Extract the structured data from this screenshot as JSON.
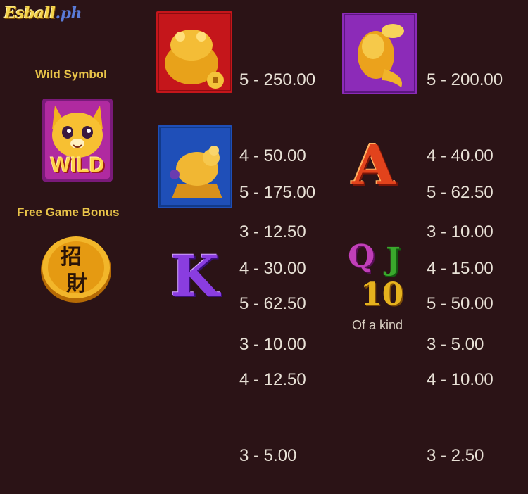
{
  "logo": {
    "main": "Esball",
    "suffix": ".ph"
  },
  "wild": {
    "label": "Wild Symbol",
    "badge": "WILD"
  },
  "bonus": {
    "label": "Free Game Bonus",
    "glyph1": "招",
    "glyph2": "財"
  },
  "symbols": [
    {
      "name": "golden-toad",
      "bg": "#c5161b",
      "lines": [
        "5 - 250.00",
        "4 - 50.00",
        "3 - 12.50"
      ]
    },
    {
      "name": "golden-koi",
      "bg": "#8c2bb8",
      "lines": [
        "5 - 200.00",
        "4 - 40.00",
        "3 - 10.00"
      ]
    },
    {
      "name": "golden-rat",
      "bg": "#1f4fb8",
      "lines": [
        "5 - 175.00",
        "4 - 30.00",
        "3 - 10.00"
      ]
    },
    {
      "name": "letter-a",
      "glyph": "A",
      "lines": [
        "5 - 62.50",
        "4 - 15.00",
        "3 - 5.00"
      ]
    },
    {
      "name": "letter-k",
      "glyph": "K",
      "lines": [
        "5 - 62.50",
        "4 - 12.50",
        "3 - 5.00"
      ]
    },
    {
      "name": "letters-qj10",
      "q": "Q",
      "j": "J",
      "ten": "10",
      "caption": "Of a kind",
      "lines": [
        "5 - 50.00",
        "4 - 10.00",
        "3 - 2.50"
      ]
    }
  ]
}
